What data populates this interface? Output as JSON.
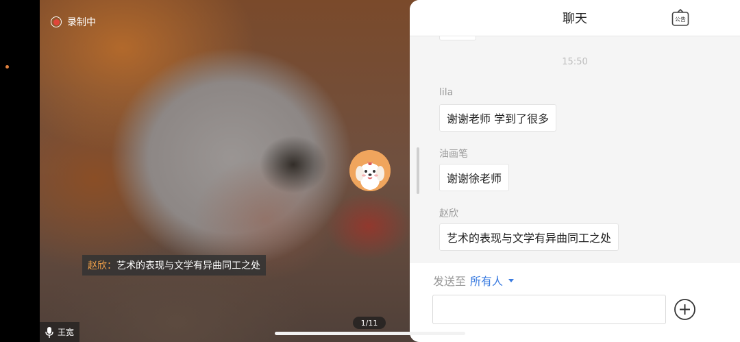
{
  "recording": {
    "label": "录制中"
  },
  "video": {
    "subtitle": {
      "speaker": "赵欣：",
      "text": "艺术的表现与文学有异曲同工之处"
    },
    "bottom_user": {
      "name": "王宽"
    },
    "page_indicator": "1/11"
  },
  "chat": {
    "title": "聊天",
    "notice_icon_label": "公告",
    "timestamp": "15:50",
    "messages": [
      {
        "name": "lila",
        "text": "谢谢老师 学到了很多"
      },
      {
        "name": "油画笔",
        "text": "谢谢徐老师"
      },
      {
        "name": "赵欣",
        "text": "艺术的表现与文学有异曲同工之处"
      }
    ],
    "send_to_label": "发送至",
    "send_to_target": "所有人",
    "input_value": "",
    "input_placeholder": ""
  },
  "colors": {
    "accent_blue": "#3a7be0",
    "record_red": "#e0453a",
    "speaker_orange": "#f0a049"
  }
}
